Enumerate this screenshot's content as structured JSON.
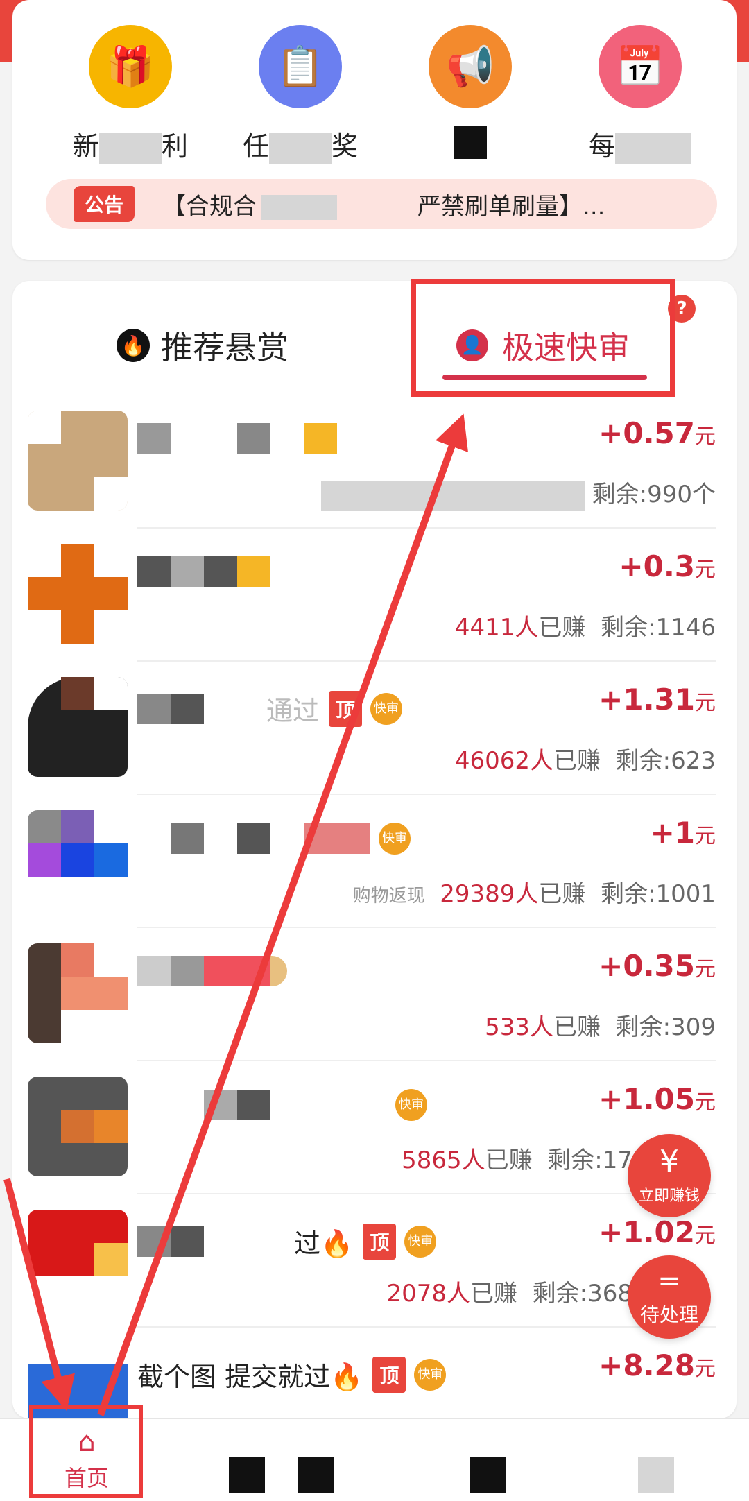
{
  "top_grid": {
    "items": [
      {
        "label_start": "新",
        "label_end": "利",
        "icon": "gift-box-icon",
        "color": "#f7b500"
      },
      {
        "label_start": "任",
        "label_end": "奖",
        "icon": "clipboard-icon",
        "color": "#6b7ff0"
      },
      {
        "label_start": "",
        "label_end": "",
        "icon": "megaphone-icon",
        "color": "#f38a2d"
      },
      {
        "label_start": "每",
        "label_end": "",
        "icon": "calendar-check-icon",
        "color": "#f2627b"
      }
    ]
  },
  "notice": {
    "badge": "公告",
    "text_start": "【合规合",
    "text_end": "严禁刷单刷量】..."
  },
  "tabs": {
    "recommend": "推荐悬赏",
    "fast_review": "极速快审",
    "help": "?"
  },
  "tasks": [
    {
      "title": "",
      "reward": "+0.57",
      "unit": "元",
      "earned": "",
      "remaining": "剩余:990个",
      "has_top": false,
      "has_fast": false
    },
    {
      "title": "",
      "reward": "+0.3",
      "unit": "元",
      "earned": "4411人",
      "earned_suffix": "已赚",
      "remaining": "剩余:1146",
      "has_top": false,
      "has_fast": false
    },
    {
      "title": "通过",
      "reward": "+1.31",
      "unit": "元",
      "earned": "46062人",
      "earned_suffix": "已赚",
      "remaining": "剩余:623",
      "has_top": true,
      "has_fast": true
    },
    {
      "title": "",
      "reward": "+1",
      "unit": "元",
      "earned": "29389人",
      "earned_suffix": "已赚",
      "remaining": "剩余:1001",
      "sub": "购物返现",
      "has_top": false,
      "has_fast": true
    },
    {
      "title": "",
      "reward": "+0.35",
      "unit": "元",
      "earned": "533人",
      "earned_suffix": "已赚",
      "remaining": "剩余:309",
      "has_top": false,
      "has_fast": false
    },
    {
      "title": "",
      "reward": "+1.05",
      "unit": "元",
      "earned": "5865人",
      "earned_suffix": "已赚",
      "remaining": "剩余:17",
      "has_top": false,
      "has_fast": true
    },
    {
      "title": "过🔥",
      "reward": "+1.02",
      "unit": "元",
      "earned": "2078人",
      "earned_suffix": "已赚",
      "remaining": "剩余:368",
      "has_top": true,
      "has_fast": true
    },
    {
      "title": "截个图 提交就过🔥",
      "reward": "+8.28",
      "unit": "元",
      "earned": "",
      "remaining": "",
      "has_top": true,
      "has_fast": true
    }
  ],
  "tag_labels": {
    "top": "顶",
    "fast": "快审"
  },
  "floating": {
    "earn_now_symbol": "¥",
    "earn_now": "立即赚钱",
    "pending_symbol": "=",
    "pending": "待处理"
  },
  "bottom_nav": {
    "home": "首页",
    "home_icon": "home-icon"
  },
  "colors": {
    "brand_red": "#e8453c",
    "reward_red": "#c8283c",
    "annotation_red": "#ec3b3b"
  }
}
